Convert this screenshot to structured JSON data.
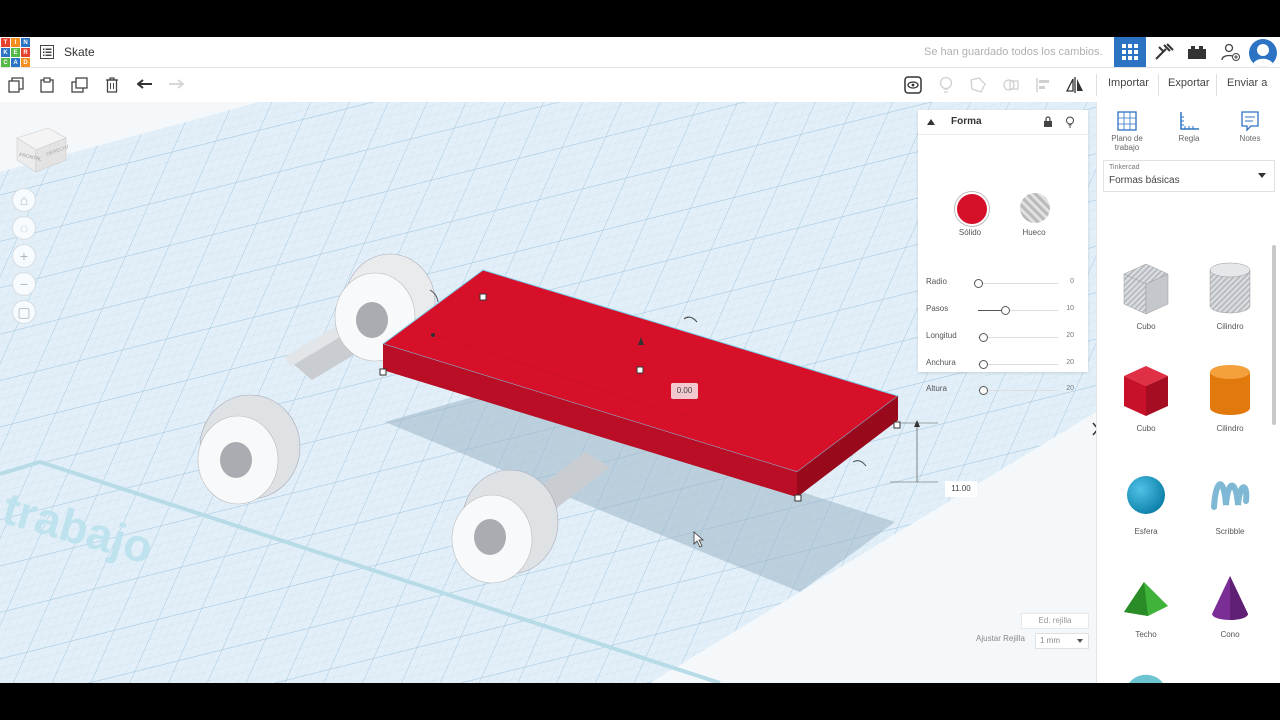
{
  "header": {
    "logo_letters": [
      "TIN",
      "KER",
      "CAD"
    ],
    "project_name": "Skate",
    "save_status": "Se han guardado todos los cambios."
  },
  "toolbar": {
    "import_label": "Importar",
    "export_label": "Exportar",
    "send_label": "Enviar a"
  },
  "viewcube": {
    "front_label": "FRONTAL",
    "back_label": "DERECHA"
  },
  "workplane": {
    "watermark": "trabajo"
  },
  "measurements": {
    "rotation_value": "0.00",
    "height_value": "11.00"
  },
  "inspector": {
    "title": "Forma",
    "solid_label": "Sólido",
    "hole_label": "Hueco",
    "solid_color": "#d7102a",
    "params": [
      {
        "label": "Radio",
        "value": "0"
      },
      {
        "label": "Pasos",
        "value": "10"
      },
      {
        "label": "Longitud",
        "value": "20"
      },
      {
        "label": "Anchura",
        "value": "20"
      },
      {
        "label": "Altura",
        "value": "20"
      }
    ]
  },
  "sidebar": {
    "tools": [
      {
        "label": "Plano de trabajo"
      },
      {
        "label": "Regla"
      },
      {
        "label": "Notes"
      }
    ],
    "library_source": "Tinkercad",
    "library_name": "Formas básicas",
    "shapes": [
      {
        "label": "Cubo",
        "icon": "cube-hole-icon"
      },
      {
        "label": "Cilindro",
        "icon": "cylinder-hole-icon"
      },
      {
        "label": "Cubo",
        "icon": "cube-red-icon"
      },
      {
        "label": "Cilindro",
        "icon": "cylinder-orange-icon"
      },
      {
        "label": "Esfera",
        "icon": "sphere-icon"
      },
      {
        "label": "Scribble",
        "icon": "scribble-icon"
      },
      {
        "label": "Techo",
        "icon": "roof-icon"
      },
      {
        "label": "Cono",
        "icon": "cone-icon"
      }
    ]
  },
  "grid": {
    "edit_label": "Ed. rejilla",
    "snap_label": "Ajustar Rejilla",
    "snap_value": "1 mm"
  }
}
